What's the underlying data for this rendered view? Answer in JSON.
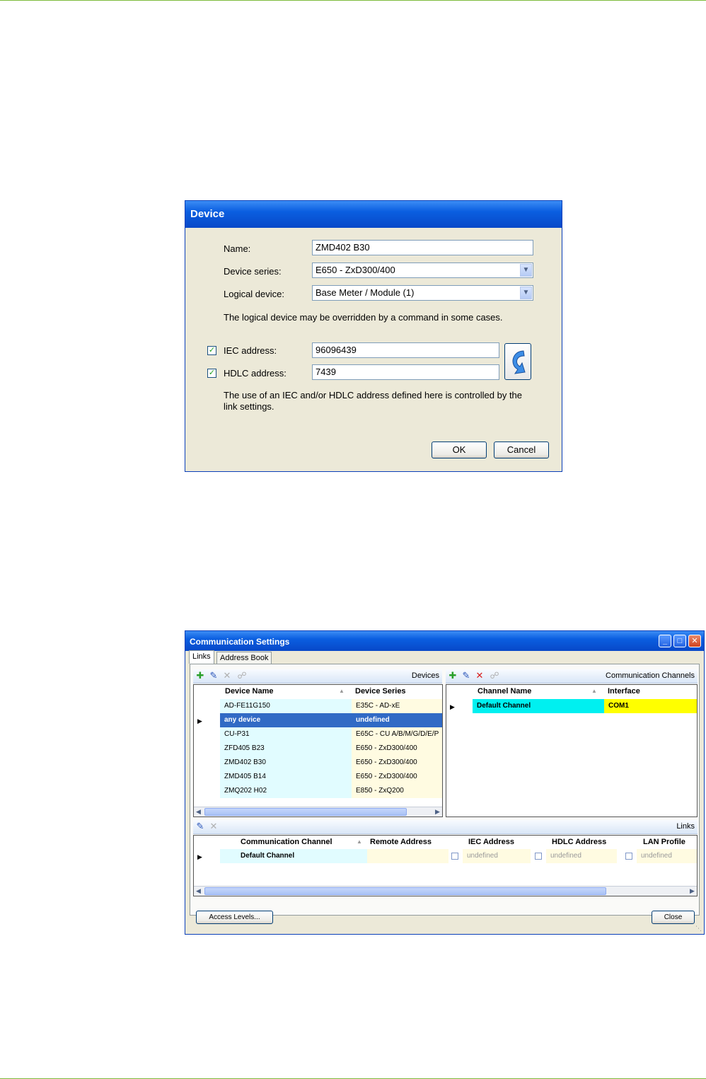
{
  "device_dialog": {
    "title": "Device",
    "name_label": "Name:",
    "name_value": "ZMD402 B30",
    "series_label": "Device series:",
    "series_value": "E650 - ZxD300/400",
    "logical_label": "Logical device:",
    "logical_value": "Base Meter / Module  (1)",
    "logical_note": "The logical device may be overridden by a command in some cases.",
    "iec_label": "IEC address:",
    "iec_value": "96096439",
    "iec_checked": true,
    "hdlc_label": "HDLC address:",
    "hdlc_value": "7439",
    "hdlc_checked": true,
    "address_note_1": "The use of an IEC and/or HDLC address defined here is controlled by the",
    "address_note_2": "link settings.",
    "ok_label": "OK",
    "cancel_label": "Cancel"
  },
  "comm_settings": {
    "title": "Communication Settings",
    "tabs": [
      {
        "label": "Links"
      },
      {
        "label": "Address Book"
      }
    ],
    "devices_label": "Devices",
    "channels_label": "Communication Channels",
    "links_label": "Links",
    "device_columns": [
      "Device Name",
      "Device Series"
    ],
    "devices": [
      {
        "name": "AD-FE11G150",
        "series": "E35C - AD-xE"
      },
      {
        "name": "any device",
        "series": "undefined"
      },
      {
        "name": "CU-P31",
        "series": "E65C - CU A/B/M/G/D/E/P"
      },
      {
        "name": "ZFD405 B23",
        "series": "E650 - ZxD300/400"
      },
      {
        "name": "ZMD402 B30",
        "series": "E650 - ZxD300/400"
      },
      {
        "name": "ZMD405 B14",
        "series": "E650 - ZxD300/400"
      },
      {
        "name": "ZMQ202 H02",
        "series": "E850 - ZxQ200"
      }
    ],
    "channel_columns": [
      "Channel Name",
      "Interface"
    ],
    "channels": [
      {
        "name": "Default Channel",
        "interface": "COM1"
      }
    ],
    "link_columns": [
      "Communication Channel",
      "Remote Address",
      "IEC Address",
      "HDLC Address",
      "LAN Profile"
    ],
    "links": [
      {
        "channel": "Default Channel",
        "remote": "",
        "iec": "undefined",
        "hdlc": "undefined",
        "lan": "undefined"
      }
    ],
    "access_levels_label": "Access Levels...",
    "close_label": "Close"
  },
  "colors": {
    "accent_rule": "#7dbb3c",
    "title_bar": "#0a5ee0",
    "selected_row": "#316ac5",
    "device_cell": "#e1fcff",
    "series_cell": "#fffbe1",
    "channel_cell": "#00f0f0",
    "interface_cell": "#ffff00"
  }
}
